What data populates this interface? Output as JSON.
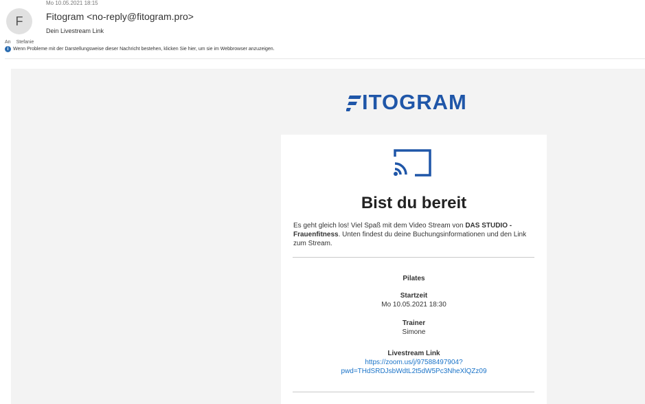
{
  "header": {
    "avatar_initial": "F",
    "date": "Mo 10.05.2021 18:15",
    "sender": "Fitogram <no-reply@fitogram.pro>",
    "subject": "Dein Livestream Link",
    "to_label": "An",
    "to_value": "Stefanie",
    "info_text": "Wenn Probleme mit der Darstellungsweise dieser Nachricht bestehen, klicken Sie hier, um sie im Webbrowser anzuzeigen."
  },
  "email": {
    "logo_text": "ITOGRAM",
    "brand_color": "#1f56a8",
    "title": "Bist du bereit",
    "intro_part1": "Es geht gleich los! Viel Spaß mit dem Video Stream von ",
    "intro_bold": "DAS STUDIO - Frauenfitness",
    "intro_part2": ". Unten findest du deine Buchungsinformationen und den Link zum Stream.",
    "class_name": "Pilates",
    "start_label": "Startzeit",
    "start_value": "Mo 10.05.2021 18:30",
    "trainer_label": "Trainer",
    "trainer_value": "Simone",
    "livestream_label": "Livestream Link",
    "livestream_link_line1": "https://zoom.us/j/97588497904?",
    "livestream_link_line2": "pwd=THdSRDJsbWdtL2t5dW5Pc3NheXlQZz09",
    "icon": "cast-icon"
  }
}
